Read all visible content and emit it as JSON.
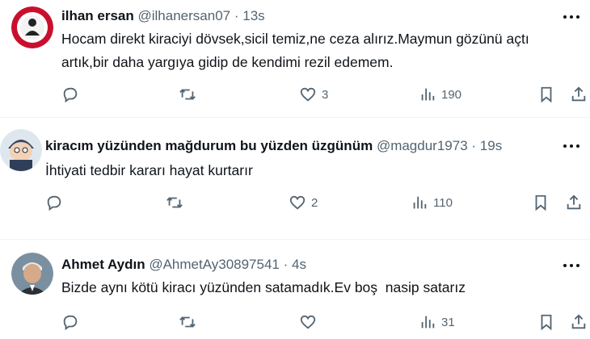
{
  "tweets": [
    {
      "name": "ilhan ersan",
      "handle": "@ilhanersan07",
      "dot": "·",
      "time": "13s",
      "text_lines": [
        "Hocam direkt kiraciyi dövsek,sicil temiz,ne ceza alırız.Maymun gözünü açtı",
        "artık,bir daha yargıya gidip de kendimi rezil edemem."
      ],
      "likes": "3",
      "views": "190",
      "replies": "",
      "retweets": ""
    },
    {
      "name": "kiracım yüzünden mağdurum bu yüzden üzgünüm",
      "handle": "@magdur1973",
      "dot": "·",
      "time": "19s",
      "text_lines": [
        "İhtiyati tedbir kararı hayat kurtarır"
      ],
      "likes": "2",
      "views": "110",
      "replies": "",
      "retweets": ""
    },
    {
      "name": "Ahmet Aydın",
      "handle": "@AhmetAy30897541",
      "dot": "·",
      "time": "4s",
      "text_lines": [
        "Bizde aynı kötü kiracı yüzünden satamadık.Ev boş  nasip satarız"
      ],
      "likes": "",
      "views": "31",
      "replies": "",
      "retweets": ""
    }
  ],
  "colors": {
    "text": "#0f1419",
    "muted": "#536471",
    "divider": "#eff3f4"
  },
  "icons": [
    "reply-icon",
    "retweet-icon",
    "like-icon",
    "views-icon",
    "bookmark-icon",
    "share-icon",
    "more-icon"
  ]
}
